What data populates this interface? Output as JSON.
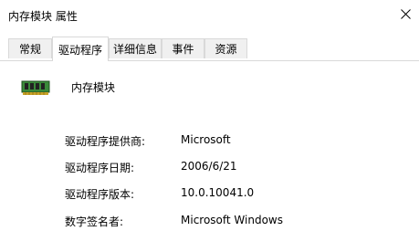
{
  "window": {
    "title": "内存模块 属性"
  },
  "tabs": [
    {
      "label": "常规"
    },
    {
      "label": "驱动程序"
    },
    {
      "label": "详细信息"
    },
    {
      "label": "事件"
    },
    {
      "label": "资源"
    }
  ],
  "active_tab": "驱动程序",
  "device": {
    "name": "内存模块",
    "icon": "memory-module-icon"
  },
  "driver_info": [
    {
      "label": "驱动程序提供商:",
      "value": "Microsoft"
    },
    {
      "label": "驱动程序日期:",
      "value": "2006/6/21"
    },
    {
      "label": "驱动程序版本:",
      "value": "10.0.10041.0"
    },
    {
      "label": "数字签名者:",
      "value": "Microsoft Windows"
    }
  ],
  "colors": {
    "tab_border": "#d9d9d9",
    "tab_inactive_bg": "#f0f0f0",
    "chip_green": "#2e7d32"
  }
}
